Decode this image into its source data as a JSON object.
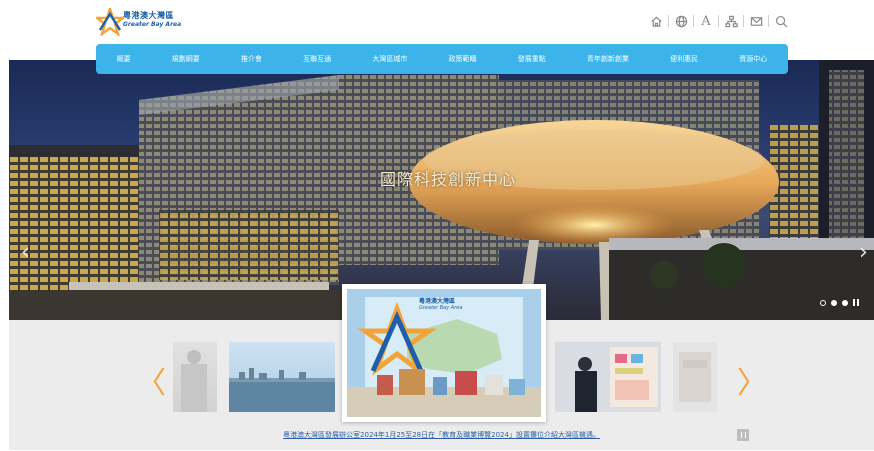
{
  "header": {
    "logo_cn": "粵港澳大灣區",
    "logo_en": "Greater Bay Area",
    "tools": [
      "home-icon",
      "globe-icon",
      "font-size-icon",
      "sitemap-icon",
      "mail-icon",
      "search-icon"
    ],
    "tool_font_label": "A"
  },
  "nav": {
    "items": [
      "概要",
      "規劃綱要",
      "推介會",
      "互聯互通",
      "大灣區城市",
      "政策範疇",
      "發展重點",
      "青年創新創業",
      "便利惠民",
      "資源中心"
    ]
  },
  "hero": {
    "title": "國際科技創新中心",
    "prev": "‹",
    "next": "›",
    "slide_count": 3,
    "active_slide": 1
  },
  "carousel": {
    "prev": "〈",
    "next": "〉",
    "featured_logo_cn": "粵港澳大灣區",
    "featured_logo_en": "Greater Bay Area",
    "caption": "粵港澳大灣區發展辦公室2024年1月25至28日在「教育及職業博覽2024」設置攤位介紹大灣區機遇。"
  },
  "colors": {
    "nav": "#3cb4ea",
    "accent_orange": "#f2a33a",
    "brand_blue": "#1d5fa8",
    "caption_link": "#2c5ea8"
  }
}
